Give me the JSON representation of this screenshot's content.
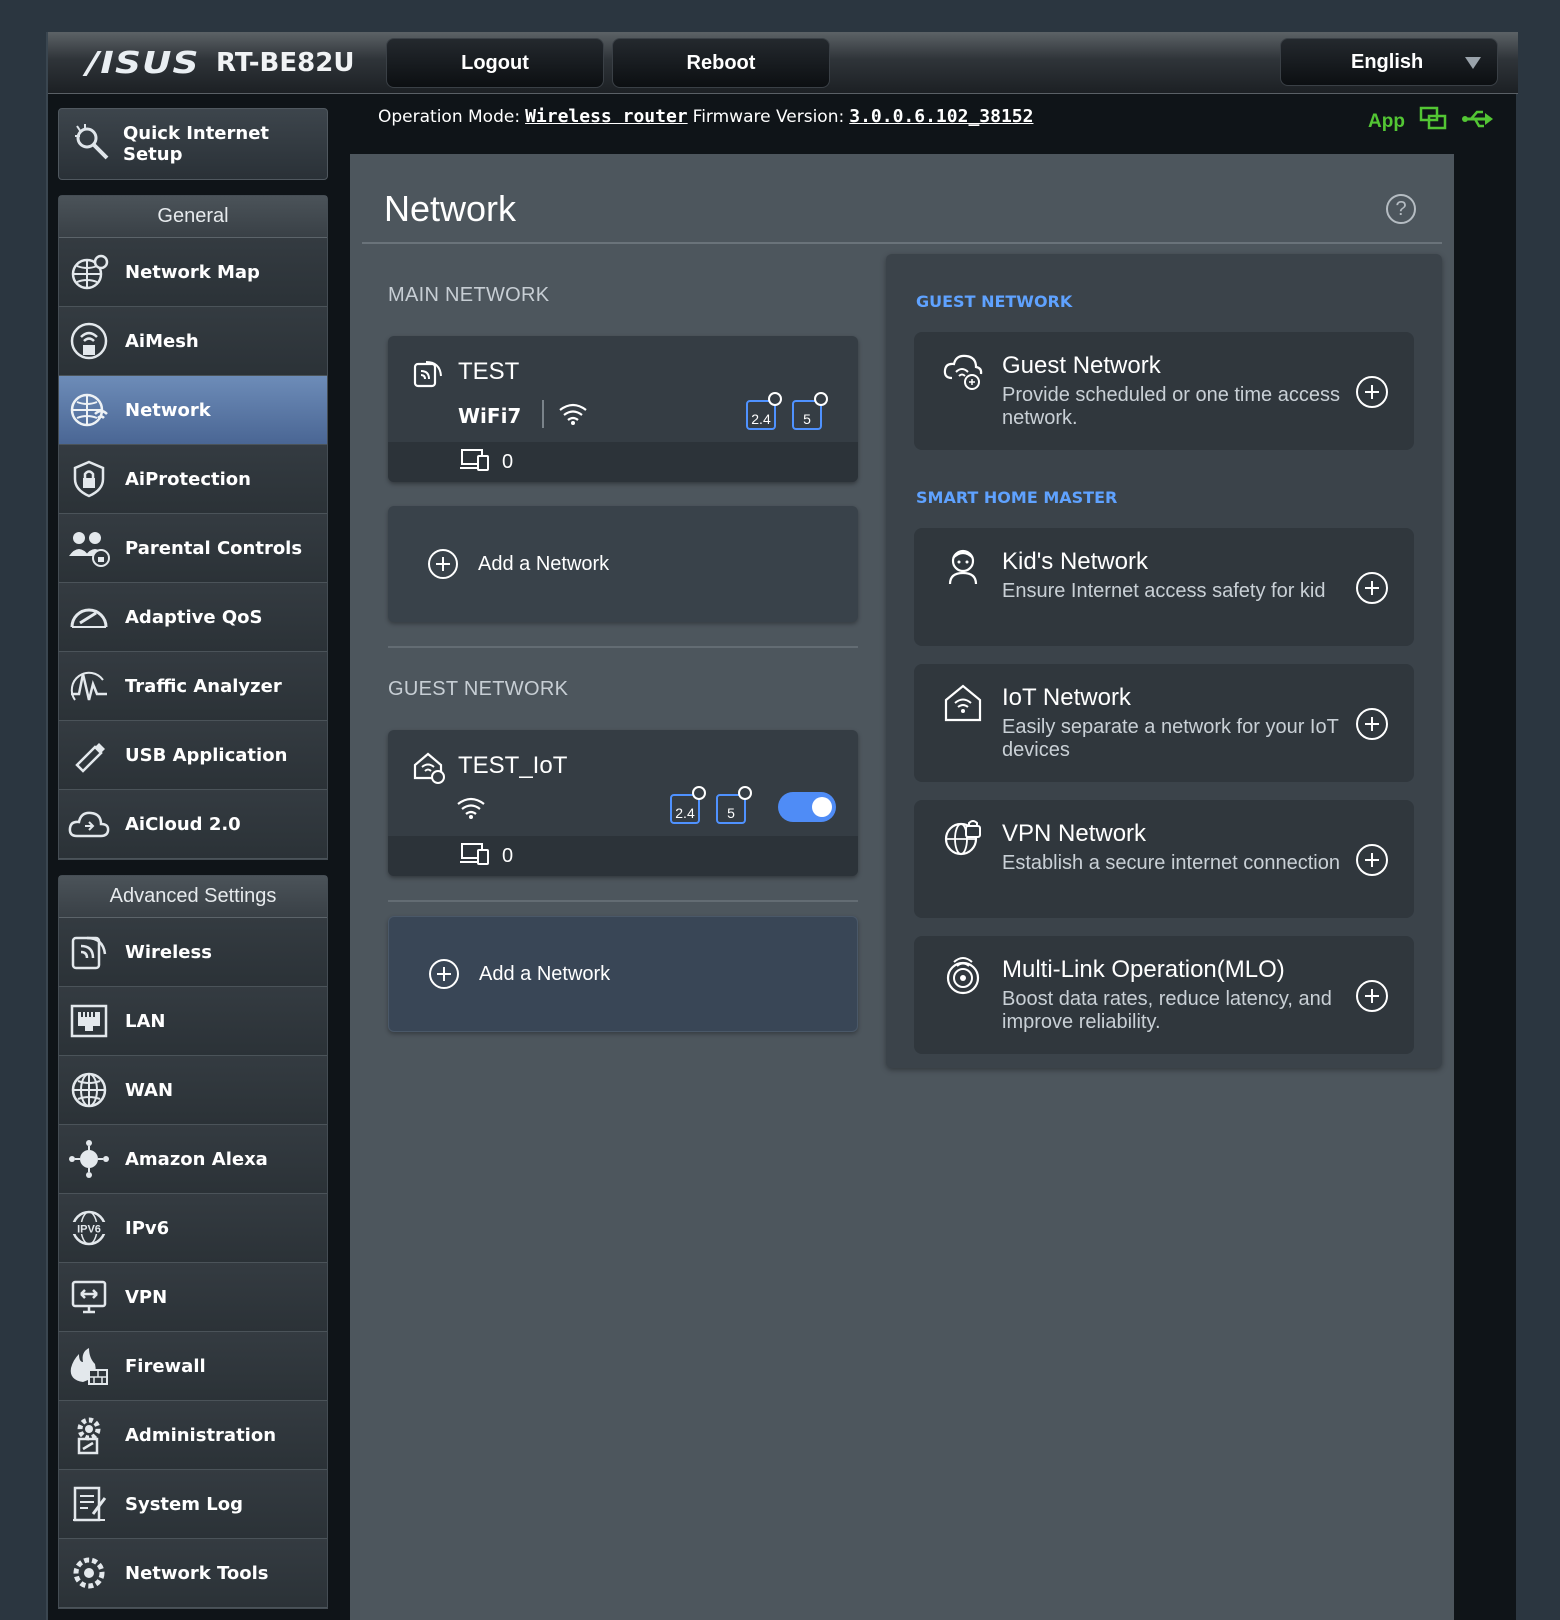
{
  "header": {
    "brand": "/ISUS",
    "model": "RT-BE82U",
    "logout_label": "Logout",
    "reboot_label": "Reboot",
    "language": "English"
  },
  "status": {
    "op_mode_label": "Operation Mode:",
    "op_mode_value": "Wireless router",
    "fw_label": "Firmware Version:",
    "fw_value": "3.0.0.6.102_38152",
    "app_label": "App"
  },
  "sidebar": {
    "qis_label_1": "Quick Internet",
    "qis_label_2": "Setup",
    "general_title": "General",
    "general": [
      {
        "label": "Network Map",
        "icon": "network-map-icon"
      },
      {
        "label": "AiMesh",
        "icon": "aimesh-icon"
      },
      {
        "label": "Network",
        "icon": "network-icon"
      },
      {
        "label": "AiProtection",
        "icon": "shield-icon"
      },
      {
        "label": "Parental Controls",
        "icon": "parental-icon"
      },
      {
        "label": "Adaptive QoS",
        "icon": "gauge-icon"
      },
      {
        "label": "Traffic Analyzer",
        "icon": "traffic-icon"
      },
      {
        "label": "USB Application",
        "icon": "usb-icon"
      },
      {
        "label": "AiCloud 2.0",
        "icon": "cloud-icon"
      }
    ],
    "advanced_title": "Advanced Settings",
    "advanced": [
      {
        "label": "Wireless",
        "icon": "wireless-icon"
      },
      {
        "label": "LAN",
        "icon": "lan-icon"
      },
      {
        "label": "WAN",
        "icon": "globe-icon"
      },
      {
        "label": "Amazon Alexa",
        "icon": "alexa-icon"
      },
      {
        "label": "IPv6",
        "icon": "ipv6-icon"
      },
      {
        "label": "VPN",
        "icon": "vpn-icon"
      },
      {
        "label": "Firewall",
        "icon": "firewall-icon"
      },
      {
        "label": "Administration",
        "icon": "admin-icon"
      },
      {
        "label": "System Log",
        "icon": "log-icon"
      },
      {
        "label": "Network Tools",
        "icon": "tools-icon"
      }
    ]
  },
  "main": {
    "title": "Network",
    "main_network_label": "MAIN NETWORK",
    "main_card": {
      "name": "TEST",
      "wifi_label": "WiFi7",
      "band_24": "2.4",
      "band_5": "5",
      "clients": "0"
    },
    "add_network_label": "Add a Network",
    "guest_network_label": "GUEST NETWORK",
    "guest_card": {
      "name": "TEST_IoT",
      "band_24": "2.4",
      "band_5": "5",
      "clients": "0",
      "enabled": true
    }
  },
  "right": {
    "guest_label": "GUEST NETWORK",
    "smart_label": "SMART HOME MASTER",
    "options": [
      {
        "title": "Guest Network",
        "desc": "Provide scheduled or one time access network.",
        "icon": "guest-cloud-icon"
      },
      {
        "title": "Kid's Network",
        "desc": "Ensure Internet access safety for kid",
        "icon": "kid-icon"
      },
      {
        "title": "IoT Network",
        "desc": "Easily separate a network for your IoT devices",
        "icon": "iot-home-icon"
      },
      {
        "title": "VPN Network",
        "desc": "Establish a secure internet connection",
        "icon": "vpn-globe-icon"
      },
      {
        "title": "Multi-Link Operation(MLO)",
        "desc": "Boost data rates, reduce latency, and improve reliability.",
        "icon": "mlo-icon"
      }
    ]
  },
  "colors": {
    "accent": "#4f8cf6",
    "active_nav": "#5b79a6",
    "label_blue": "#5fa2ff",
    "app_green": "#53c634"
  }
}
